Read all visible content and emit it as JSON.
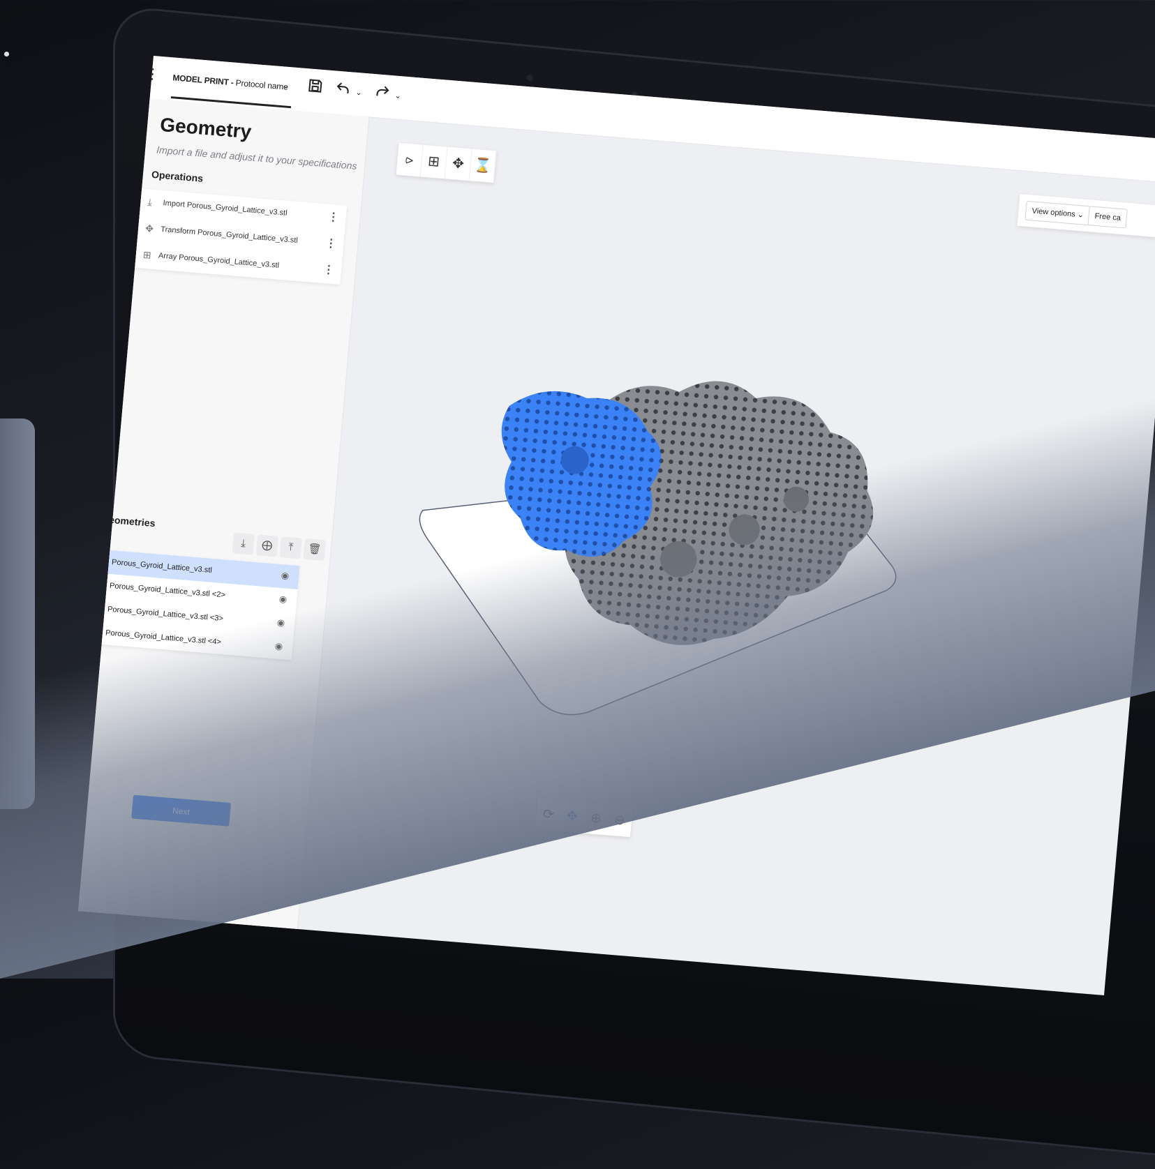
{
  "topbar": {
    "protocol_prefix": "MODEL PRINT - ",
    "protocol_name": "Protocol name"
  },
  "panel": {
    "title": "Geometry",
    "subtitle": "Import a file and adjust it to your specifications",
    "operations_label": "Operations",
    "operations": [
      {
        "icon": "import-icon",
        "label": "Import Porous_Gyroid_Lattice_v3.stl"
      },
      {
        "icon": "move-icon",
        "label": "Transform Porous_Gyroid_Lattice_v3.stl"
      },
      {
        "icon": "array-icon",
        "label": "Array Porous_Gyroid_Lattice_v3.stl"
      }
    ],
    "geometries_label": "Geometries",
    "geometries": [
      {
        "label": "Porous_Gyroid_Lattice_v3.stl",
        "selected": true
      },
      {
        "label": "Porous_Gyroid_Lattice_v3.stl <2>",
        "selected": false
      },
      {
        "label": "Porous_Gyroid_Lattice_v3.stl <3>",
        "selected": false
      },
      {
        "label": "Porous_Gyroid_Lattice_v3.stl <4>",
        "selected": false
      }
    ],
    "next_label": "Next"
  },
  "viewport": {
    "view_options_label": "View options",
    "camera_label": "Free ca"
  },
  "colors": {
    "accent": "#2f6fe4",
    "selected_row": "#cfe0ff",
    "lattice_blue": "#3b82f6",
    "lattice_gray": "#7d7f84"
  }
}
